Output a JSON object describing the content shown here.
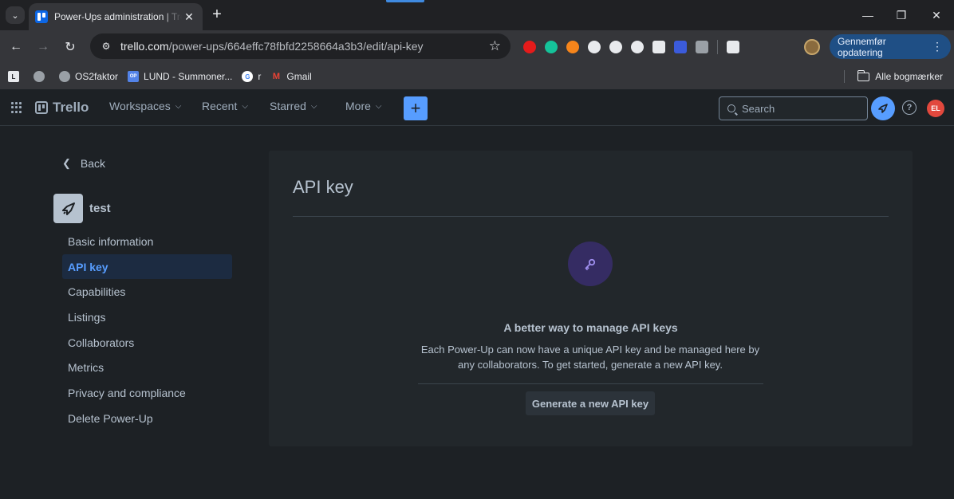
{
  "browser": {
    "tab": {
      "title": "Power-Ups administration | Trello"
    },
    "address_bar": {
      "domain": "trello.com",
      "path": "/power-ups/664effc78fbfd2258664a3b3/edit/api-key"
    },
    "update_button": {
      "label": "Gennemfør opdatering"
    },
    "bookmarks": [
      {
        "label": "",
        "icon": "L"
      },
      {
        "label": "",
        "icon": "globe"
      },
      {
        "label": "OS2faktor",
        "icon": "globe"
      },
      {
        "label": "LUND - Summoner...",
        "icon": "OP.GG"
      },
      {
        "label": "r",
        "icon": "G"
      },
      {
        "label": "Gmail",
        "icon": "M"
      }
    ],
    "all_bookmarks": "Alle bogmærker",
    "extension_colors": [
      "#e51b1b",
      "#15c39a",
      "#f6851b",
      "#e8eaed",
      "#e8eaed",
      "#e8eaed",
      "#e8eaed",
      "#3b5bdb",
      "#9aa0a6",
      "#e8eaed"
    ]
  },
  "header": {
    "brand": "Trello",
    "nav": [
      {
        "label": "Workspaces"
      },
      {
        "label": "Recent"
      },
      {
        "label": "Starred"
      },
      {
        "label": "More"
      }
    ],
    "create_label": "+",
    "search_placeholder": "Search",
    "user_initials": "EL"
  },
  "sidebar": {
    "back_label": "Back",
    "powerup_name": "test",
    "items": [
      {
        "label": "Basic information",
        "active": false
      },
      {
        "label": "API key",
        "active": true
      },
      {
        "label": "Capabilities",
        "active": false
      },
      {
        "label": "Listings",
        "active": false
      },
      {
        "label": "Collaborators",
        "active": false
      },
      {
        "label": "Metrics",
        "active": false
      },
      {
        "label": "Privacy and compliance",
        "active": false
      },
      {
        "label": "Delete Power-Up",
        "active": false
      }
    ]
  },
  "panel": {
    "title": "API key",
    "empty_heading": "A better way to manage API keys",
    "empty_description": "Each Power-Up can now have a unique API key and be managed here by any collaborators. To get started, generate a new API key.",
    "generate_button": "Generate a new API key"
  },
  "colors": {
    "accent": "#579dff",
    "page_bg": "#1d2125",
    "panel_bg": "#22272b",
    "active_nav_bg": "#1c2b41",
    "key_circle_bg": "#352c63",
    "avatar_bg": "#e2483d"
  }
}
